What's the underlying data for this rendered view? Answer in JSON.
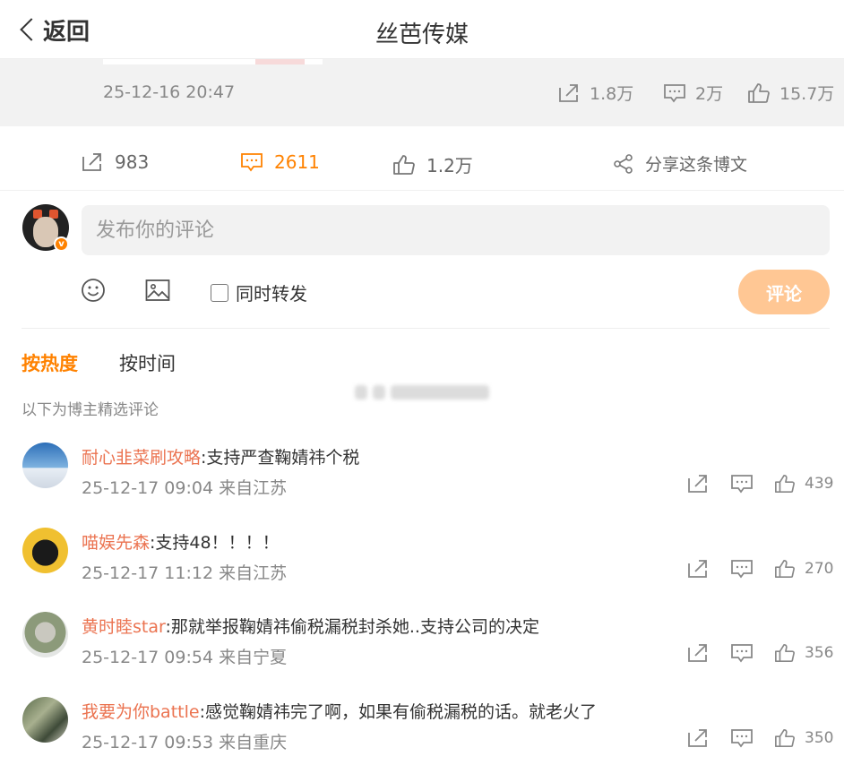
{
  "header": {
    "back_label": "返回",
    "title": "丝芭传媒"
  },
  "original_post": {
    "time": "25-12-16 20:47",
    "reposts": "1.8万",
    "comments": "2万",
    "likes": "15.7万"
  },
  "stats": {
    "reposts": "983",
    "comments": "2611",
    "likes": "1.2万",
    "share_label": "分享这条博文"
  },
  "compose": {
    "placeholder": "发布你的评论",
    "repost_label": "同时转发",
    "submit_label": "评论"
  },
  "sort": {
    "hot": "按热度",
    "time": "按时间"
  },
  "selected_note": "以下为博主精选评论",
  "colors": {
    "accent": "#ff8200",
    "username": "#eb7350",
    "submit_disabled": "#ffc794"
  },
  "comments": [
    {
      "user": "耐心韭菜刷攻略",
      "text": ":支持严查鞠婧祎个税",
      "meta": "25-12-17 09:04 来自江苏",
      "likes": "439"
    },
    {
      "user": "喵娱先森",
      "text": ":支持48！！！！",
      "meta": "25-12-17 11:12 来自江苏",
      "likes": "270"
    },
    {
      "user": "黄时睦star",
      "text": ":那就举报鞠婧祎偷税漏税封杀她..支持公司的决定",
      "meta": "25-12-17 09:54 来自宁夏",
      "likes": "356"
    },
    {
      "user": "我要为你battle",
      "text": ":感觉鞠婧祎完了啊，如果有偷税漏税的话。就老火了",
      "meta": "25-12-17 09:53 来自重庆",
      "likes": "350"
    }
  ]
}
